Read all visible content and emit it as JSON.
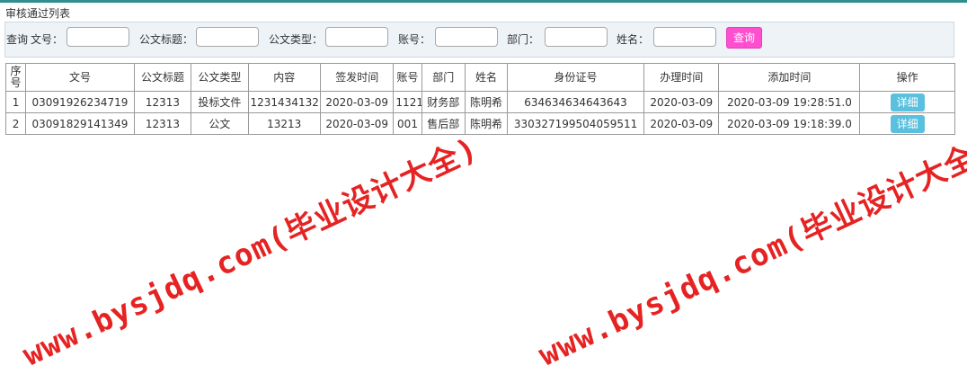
{
  "page": {
    "section_title": "审核通过列表"
  },
  "query": {
    "prefix": "查询",
    "fields": [
      {
        "label": "文号：",
        "value": ""
      },
      {
        "label": "公文标题：",
        "value": ""
      },
      {
        "label": "公文类型：",
        "value": ""
      },
      {
        "label": "账号：",
        "value": ""
      },
      {
        "label": "部门：",
        "value": ""
      },
      {
        "label": "姓名：",
        "value": ""
      }
    ],
    "button_label": "查询",
    "button_color": "#ff4fd0"
  },
  "table": {
    "headers": [
      "序号",
      "文号",
      "公文标题",
      "公文类型",
      "内容",
      "签发时间",
      "账号",
      "部门",
      "姓名",
      "身份证号",
      "办理时间",
      "添加时间",
      "操作"
    ],
    "rows": [
      {
        "cells": [
          "1",
          "03091926234719",
          "12313",
          "投标文件",
          "1231434132",
          "2020-03-09",
          "1121",
          "财务部",
          "陈明希",
          "634634634643643",
          "2020-03-09",
          "2020-03-09 19:28:51.0"
        ],
        "action": "详细"
      },
      {
        "cells": [
          "2",
          "03091829141349",
          "12313",
          "公文",
          "13213",
          "2020-03-09",
          "001",
          "售后部",
          "陈明希",
          "330327199504059511",
          "2020-03-09",
          "2020-03-09 19:18:39.0"
        ],
        "action": "详细"
      }
    ],
    "action_color": "#5bc0de"
  },
  "watermark": {
    "text": "www.bysjdq.com(毕业设计大全)",
    "color": "#e62323"
  }
}
